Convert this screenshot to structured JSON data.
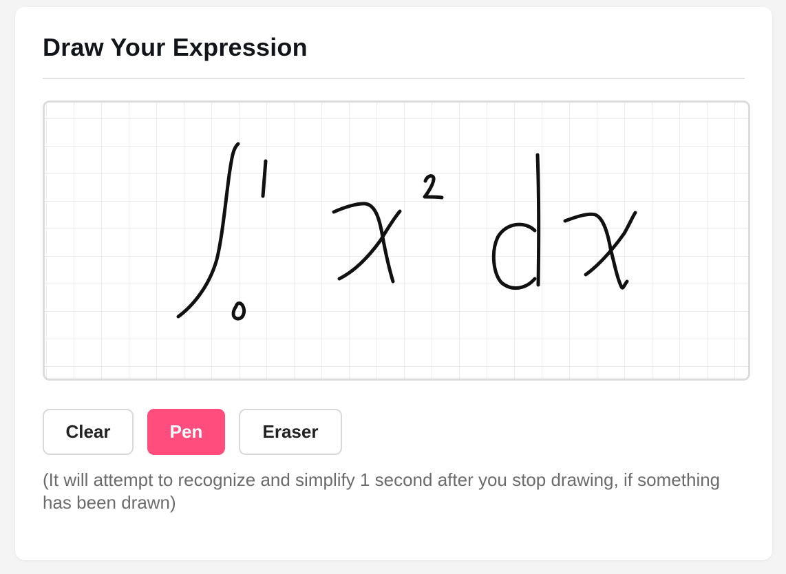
{
  "header": {
    "title": "Draw Your Expression"
  },
  "canvas": {
    "grid_color": "#e6e6e6",
    "stroke_color": "#111111",
    "content_description_icon": "handwritten-expression"
  },
  "toolbar": {
    "clear_label": "Clear",
    "pen_label": "Pen",
    "eraser_label": "Eraser",
    "active_tool": "Pen",
    "accent_color": "#ff4d7d"
  },
  "hint": {
    "text": "(It will attempt to recognize and simplify 1 second after you stop drawing, if something has been drawn)"
  }
}
